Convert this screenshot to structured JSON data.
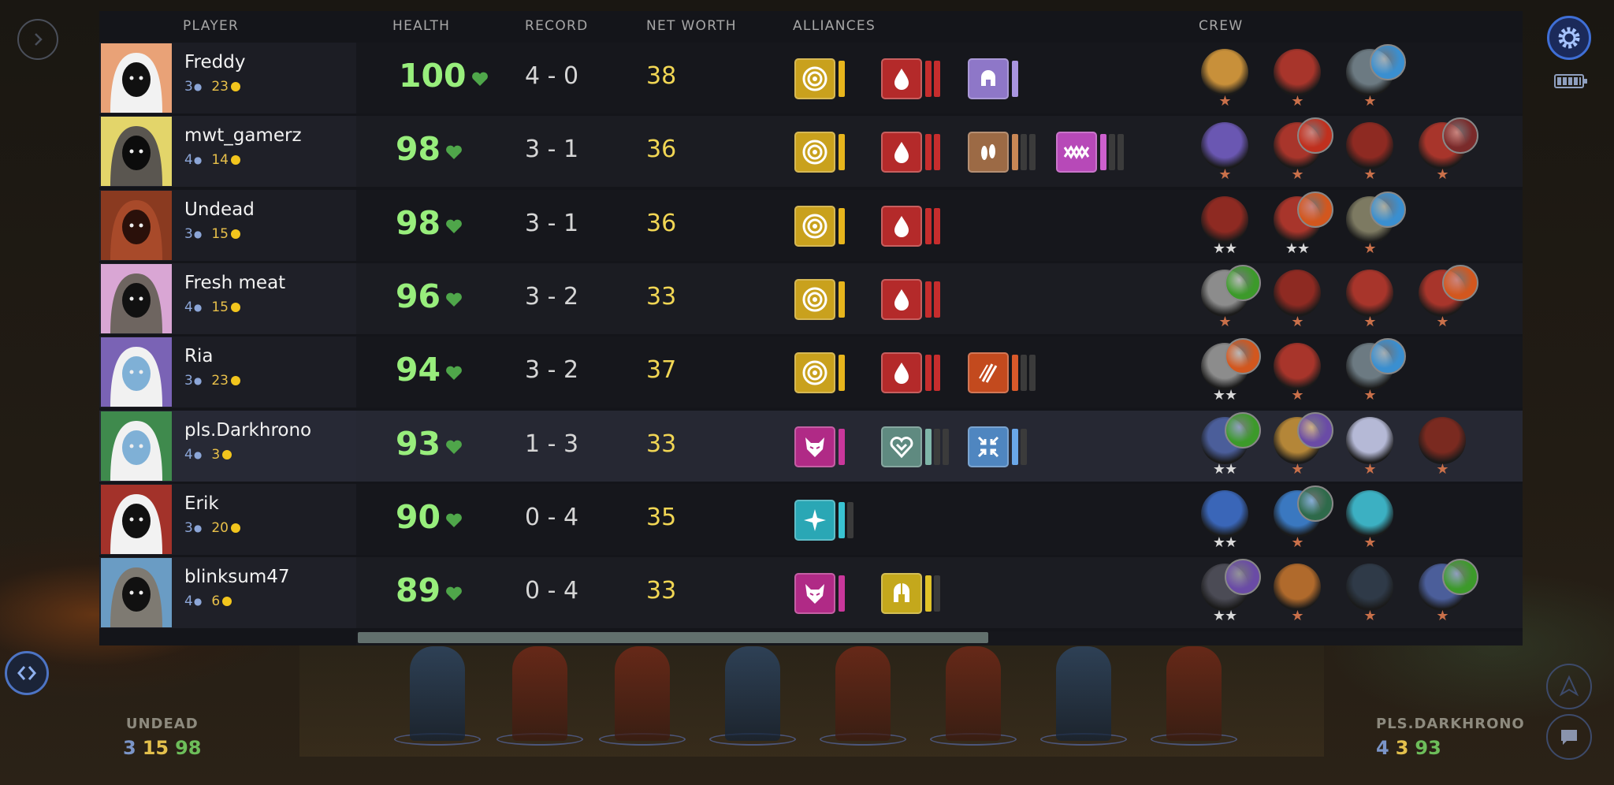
{
  "header": {
    "player": "PLAYER",
    "health": "HEALTH",
    "record": "RECORD",
    "net_worth": "NET WORTH",
    "alliances": "ALLIANCES",
    "crew": "CREW"
  },
  "players": [
    {
      "name": "Freddy",
      "level": "3",
      "gold": "23",
      "health": "100",
      "record": "4 - 0",
      "net_worth": "38",
      "avatar": "snow-hood-avatar",
      "alliances": [
        {
          "icon": "target-icon",
          "color": "#c9a11d",
          "pips": [
            "#e7b51c"
          ],
          "pip_total": 1
        },
        {
          "icon": "blood-drop-icon",
          "color": "#b42a2a",
          "pips": [
            "#c62d2d"
          ],
          "pip_total": 2
        },
        {
          "icon": "helmet-icon",
          "color": "#8e77c8",
          "pips": [
            "#a995e0"
          ],
          "pip_total": 1
        }
      ],
      "crew": [
        {
          "hero": "golden-knight-hero",
          "color": "#c8903a",
          "stars": 1,
          "item": null
        },
        {
          "hero": "red-demon-hero",
          "color": "#a8352b",
          "stars": 1,
          "item": null
        },
        {
          "hero": "walrus-hero",
          "color": "#6c7a82",
          "stars": 1,
          "item": "blue-tusk-item"
        }
      ]
    },
    {
      "name": "mwt_gamerz",
      "level": "4",
      "gold": "14",
      "health": "98",
      "record": "3 - 1",
      "net_worth": "36",
      "avatar": "hooded-figure-avatar",
      "alliances": [
        {
          "icon": "target-icon",
          "color": "#c9a11d",
          "pips": [
            "#e7b51c"
          ],
          "pip_total": 1
        },
        {
          "icon": "blood-drop-icon",
          "color": "#b42a2a",
          "pips": [
            "#c62d2d"
          ],
          "pip_total": 2
        },
        {
          "icon": "paws-icon",
          "color": "#9c6a45",
          "pips": [
            "#c98755",
            "#3b3b3b"
          ],
          "pip_total": 3
        },
        {
          "icon": "crossed-arrows-icon",
          "color": "#b749b8",
          "pips": [
            "#cd60ce",
            "#3b3b3b"
          ],
          "pip_total": 3
        }
      ],
      "crew": [
        {
          "hero": "purple-imp-hero",
          "color": "#6a57b2",
          "stars": 1,
          "item": null
        },
        {
          "hero": "red-demon-hero",
          "color": "#a8352b",
          "stars": 1,
          "item": "fire-orb-item"
        },
        {
          "hero": "red-hood-hero",
          "color": "#8e2a22",
          "stars": 1,
          "item": null
        },
        {
          "hero": "red-demon-hero",
          "color": "#a8352b",
          "stars": 1,
          "item": "skull-item"
        }
      ]
    },
    {
      "name": "Undead",
      "level": "3",
      "gold": "15",
      "health": "98",
      "record": "3 - 1",
      "net_worth": "36",
      "avatar": "autumn-tree-avatar",
      "alliances": [
        {
          "icon": "target-icon",
          "color": "#c9a11d",
          "pips": [
            "#e7b51c"
          ],
          "pip_total": 1
        },
        {
          "icon": "blood-drop-icon",
          "color": "#b42a2a",
          "pips": [
            "#c62d2d"
          ],
          "pip_total": 2
        }
      ],
      "crew": [
        {
          "hero": "red-hood-hero",
          "color": "#8e2a22",
          "stars": 2,
          "item": null
        },
        {
          "hero": "red-demon-hero",
          "color": "#a8352b",
          "stars": 2,
          "item": "flame-sword-item"
        },
        {
          "hero": "stone-hero",
          "color": "#7d7a62",
          "stars": 1,
          "item": "blue-tusk-item"
        }
      ]
    },
    {
      "name": "Fresh meat",
      "level": "4",
      "gold": "15",
      "health": "96",
      "record": "3 - 2",
      "net_worth": "33",
      "avatar": "pink-hood-avatar",
      "alliances": [
        {
          "icon": "target-icon",
          "color": "#c9a11d",
          "pips": [
            "#e7b51c"
          ],
          "pip_total": 1
        },
        {
          "icon": "blood-drop-icon",
          "color": "#b42a2a",
          "pips": [
            "#c62d2d"
          ],
          "pip_total": 2
        }
      ],
      "crew": [
        {
          "hero": "dwarf-hero",
          "color": "#8c8c8c",
          "stars": 1,
          "item": "green-gauntlet-item"
        },
        {
          "hero": "red-hood-hero",
          "color": "#8e2a22",
          "stars": 1,
          "item": null
        },
        {
          "hero": "red-demon-hero",
          "color": "#a8352b",
          "stars": 1,
          "item": null
        },
        {
          "hero": "red-demon-hero",
          "color": "#a8352b",
          "stars": 1,
          "item": "flame-sword-item"
        }
      ]
    },
    {
      "name": "Ria",
      "level": "3",
      "gold": "23",
      "health": "94",
      "record": "3 - 2",
      "net_worth": "37",
      "avatar": "chicken-avatar",
      "alliances": [
        {
          "icon": "target-icon",
          "color": "#c9a11d",
          "pips": [
            "#e7b51c"
          ],
          "pip_total": 1
        },
        {
          "icon": "blood-drop-icon",
          "color": "#b42a2a",
          "pips": [
            "#c62d2d"
          ],
          "pip_total": 2
        },
        {
          "icon": "claw-marks-icon",
          "color": "#c34a1e",
          "pips": [
            "#d9592a",
            "#3b3b3b"
          ],
          "pip_total": 3
        }
      ],
      "crew": [
        {
          "hero": "dwarf-hero",
          "color": "#8c8c8c",
          "stars": 2,
          "item": "flame-sword-item"
        },
        {
          "hero": "red-demon-hero",
          "color": "#a8352b",
          "stars": 1,
          "item": null
        },
        {
          "hero": "walrus-hero",
          "color": "#6c7a82",
          "stars": 1,
          "item": "blue-tusk-item"
        }
      ]
    },
    {
      "name": "pls.Darkhrono",
      "level": "4",
      "gold": "3",
      "health": "93",
      "record": "1 - 3",
      "net_worth": "33",
      "avatar": "chicken-green-avatar",
      "alliances": [
        {
          "icon": "demon-mask-icon",
          "color": "#b02a86",
          "pips": [
            "#c9379b"
          ],
          "pip_total": 1
        },
        {
          "icon": "heart-shield-icon",
          "color": "#5f8a80",
          "pips": [
            "#7fb5a8",
            "#3b3b3b"
          ],
          "pip_total": 3
        },
        {
          "icon": "compress-arrows-icon",
          "color": "#4f86c0",
          "pips": [
            "#6aa7e8",
            "#3b3b3b"
          ],
          "pip_total": 2
        }
      ],
      "crew": [
        {
          "hero": "blue-warrior-hero",
          "color": "#4b5e9a",
          "stars": 2,
          "item": "green-gauntlet-item"
        },
        {
          "hero": "golden-beast-hero",
          "color": "#b48638",
          "stars": 1,
          "item": "purple-orb-item"
        },
        {
          "hero": "pale-ghost-hero",
          "color": "#b5b9d6",
          "stars": 1,
          "item": null
        },
        {
          "hero": "dark-spider-hero",
          "color": "#7a2a20",
          "stars": 1,
          "item": null
        }
      ]
    },
    {
      "name": "Erik",
      "level": "3",
      "gold": "20",
      "health": "90",
      "record": "0 - 4",
      "net_worth": "35",
      "avatar": "jester-avatar",
      "alliances": [
        {
          "icon": "sparkle-icon",
          "color": "#2aa7b5",
          "pips": [
            "#39c3d2",
            "#3b3b3b"
          ],
          "pip_total": 2
        }
      ],
      "crew": [
        {
          "hero": "blue-armor-hero",
          "color": "#3a66b8",
          "stars": 2,
          "item": null
        },
        {
          "hero": "blue-ogre-hero",
          "color": "#3a78c0",
          "stars": 1,
          "item": "green-horn-item"
        },
        {
          "hero": "frost-mage-hero",
          "color": "#3cb0c2",
          "stars": 1,
          "item": null
        }
      ]
    },
    {
      "name": "blinksum47",
      "level": "4",
      "gold": "6",
      "health": "89",
      "record": "0 - 4",
      "net_worth": "33",
      "avatar": "blue-hood-avatar",
      "alliances": [
        {
          "icon": "demon-mask-icon",
          "color": "#b02a86",
          "pips": [
            "#c9379b"
          ],
          "pip_total": 1
        },
        {
          "icon": "warrior-helm-icon",
          "color": "#c4a81c",
          "pips": [
            "#e0c228",
            "#3b3b3b"
          ],
          "pip_total": 2
        }
      ],
      "crew": [
        {
          "hero": "dark-knight-hero",
          "color": "#4b4b55",
          "stars": 2,
          "item": "purple-orb-item"
        },
        {
          "hero": "bearded-warrior-hero",
          "color": "#b06a2c",
          "stars": 1,
          "item": null
        },
        {
          "hero": "shadow-assassin-hero",
          "color": "#2f3a48",
          "stars": 1,
          "item": null
        },
        {
          "hero": "blue-warrior-hero",
          "color": "#4b5e9a",
          "stars": 1,
          "item": "green-gauntlet-item"
        }
      ]
    }
  ],
  "bottom_left_player": {
    "name": "UNDEAD",
    "level": "3",
    "gold": "15",
    "health": "98"
  },
  "bottom_right_player": {
    "name": "PLS.DARKHRONO",
    "level": "4",
    "gold": "3",
    "health": "93"
  },
  "colors": {
    "health_green": "#98ee7c",
    "gold": "#f1d654",
    "star_full": "#d9d9d9",
    "star_bronze": "#c9704a",
    "settings_blue": "#3f6fd6"
  }
}
